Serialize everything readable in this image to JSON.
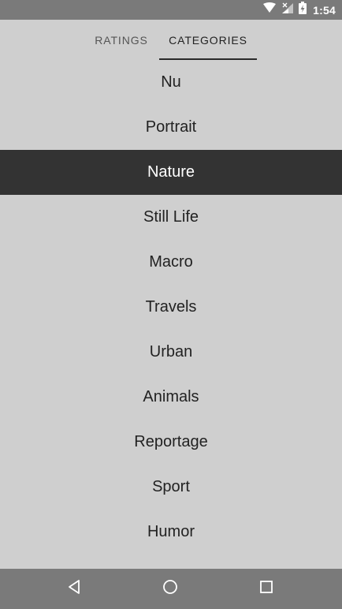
{
  "status_bar": {
    "time": "1:54",
    "icons": [
      "wifi-icon",
      "signal-icon",
      "battery-icon"
    ]
  },
  "tabs": [
    {
      "label": "RATINGS",
      "selected": false
    },
    {
      "label": "CATEGORIES",
      "selected": true
    }
  ],
  "categories": {
    "items": [
      {
        "label": "Nu",
        "selected": false
      },
      {
        "label": "Portrait",
        "selected": false
      },
      {
        "label": "Nature",
        "selected": true
      },
      {
        "label": "Still Life",
        "selected": false
      },
      {
        "label": "Macro",
        "selected": false
      },
      {
        "label": "Travels",
        "selected": false
      },
      {
        "label": "Urban",
        "selected": false
      },
      {
        "label": "Animals",
        "selected": false
      },
      {
        "label": "Reportage",
        "selected": false
      },
      {
        "label": "Sport",
        "selected": false
      },
      {
        "label": "Humor",
        "selected": false
      }
    ]
  },
  "nav_bar": {
    "buttons": [
      "back-icon",
      "home-icon",
      "recents-icon"
    ]
  },
  "colors": {
    "background": "#cfcfcf",
    "system_bar": "#7a7a7a",
    "selected_row": "#333333",
    "tab_indicator": "#2a2a2a"
  }
}
